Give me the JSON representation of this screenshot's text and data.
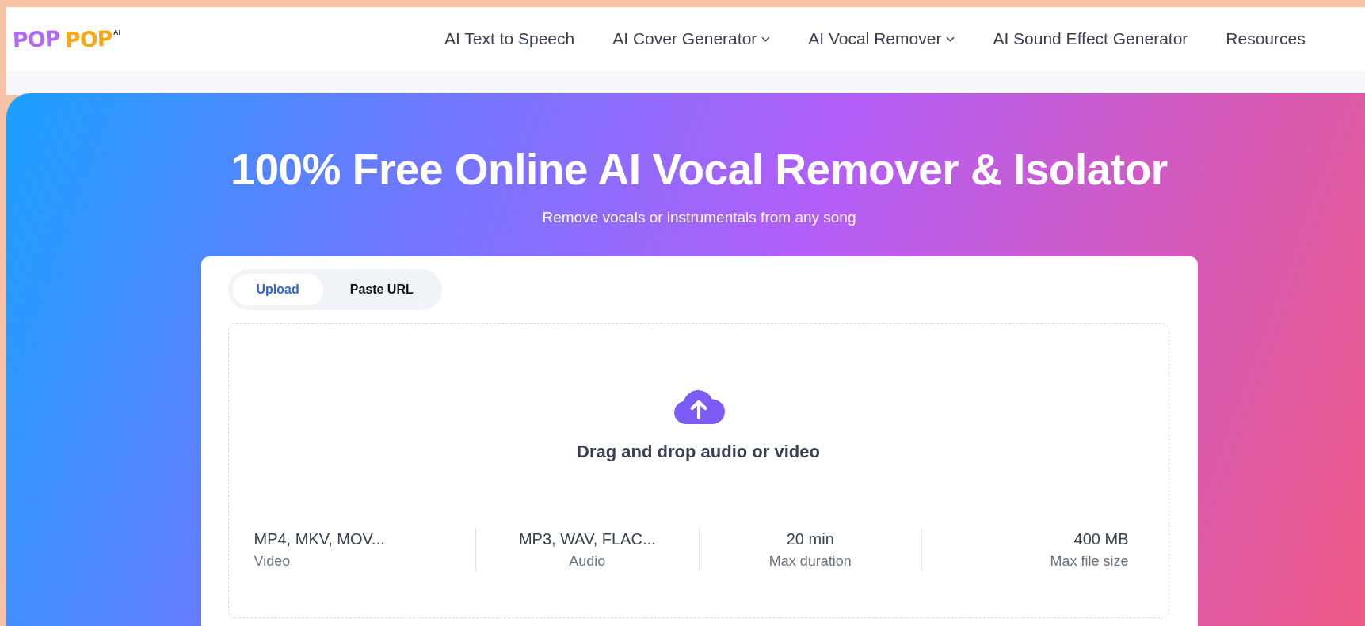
{
  "logo": {
    "word_1": "POP",
    "word_2": "POP",
    "badge": "AI"
  },
  "nav": [
    {
      "label": "AI Text to Speech",
      "dropdown": false
    },
    {
      "label": "AI Cover Generator",
      "dropdown": true
    },
    {
      "label": "AI Vocal Remover",
      "dropdown": true
    },
    {
      "label": "AI Sound Effect Generator",
      "dropdown": false
    },
    {
      "label": "Resources",
      "dropdown": false
    }
  ],
  "hero": {
    "title": "100% Free Online AI Vocal Remover & Isolator",
    "subtitle": "Remove vocals or instrumentals from any song"
  },
  "tabs": [
    {
      "label": "Upload",
      "selected": true
    },
    {
      "label": "Paste URL",
      "selected": false
    }
  ],
  "dropzone": {
    "prompt": "Drag and drop audio or video"
  },
  "specs": [
    {
      "value": "MP4, MKV, MOV...",
      "label": "Video"
    },
    {
      "value": "MP3, WAV, FLAC...",
      "label": "Audio"
    },
    {
      "value": "20 min",
      "label": "Max duration"
    },
    {
      "value": "400 MB",
      "label": "Max file size"
    }
  ]
}
